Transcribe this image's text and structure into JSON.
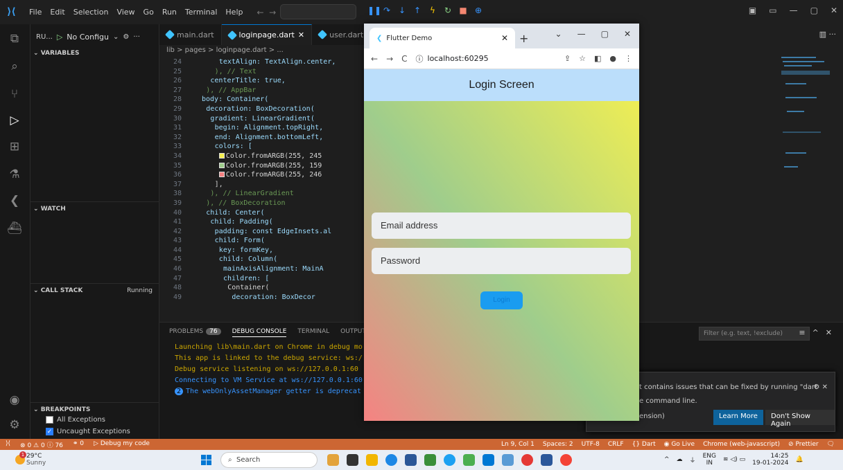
{
  "titlebar": {
    "menu": [
      "File",
      "Edit",
      "Selection",
      "View",
      "Go",
      "Run",
      "Terminal",
      "Help"
    ]
  },
  "sidebar": {
    "run_label": "RU...",
    "config_label": "No Configu",
    "sections": {
      "variables": "VARIABLES",
      "watch": "WATCH",
      "call_stack": "CALL STACK",
      "call_stack_status": "Running",
      "breakpoints": "BREAKPOINTS"
    },
    "breakpoints": [
      {
        "label": "All Exceptions",
        "checked": false
      },
      {
        "label": "Uncaught Exceptions",
        "checked": true
      }
    ]
  },
  "editor": {
    "tabs": [
      {
        "label": "main.dart",
        "active": false
      },
      {
        "label": "loginpage.dart",
        "active": true
      },
      {
        "label": "user.dart",
        "active": false
      }
    ],
    "breadcrumb": "lib > pages > loginpage.dart > ...",
    "lines": [
      {
        "n": "24",
        "code": "textAlign: TextAlign.center,"
      },
      {
        "n": "25",
        "code": "), // Text"
      },
      {
        "n": "26",
        "code": "centerTitle: true,"
      },
      {
        "n": "27",
        "code": "), // AppBar"
      },
      {
        "n": "28",
        "code": "body: Container("
      },
      {
        "n": "29",
        "code": "decoration: BoxDecoration("
      },
      {
        "n": "30",
        "code": "gradient: LinearGradient("
      },
      {
        "n": "31",
        "code": "begin: Alignment.topRight,"
      },
      {
        "n": "32",
        "code": "end: Alignment.bottomLeft,"
      },
      {
        "n": "33",
        "code": "colors: ["
      },
      {
        "n": "34",
        "code": "Color.fromARGB(255, 245"
      },
      {
        "n": "35",
        "code": "Color.fromARGB(255, 159"
      },
      {
        "n": "36",
        "code": "Color.fromARGB(255, 246"
      },
      {
        "n": "37",
        "code": "],"
      },
      {
        "n": "38",
        "code": "), // LinearGradient"
      },
      {
        "n": "39",
        "code": "), // BoxDecoration"
      },
      {
        "n": "40",
        "code": "child: Center("
      },
      {
        "n": "41",
        "code": "child: Padding("
      },
      {
        "n": "42",
        "code": "padding: const EdgeInsets.al"
      },
      {
        "n": "43",
        "code": "child: Form("
      },
      {
        "n": "44",
        "code": "key: formKey,"
      },
      {
        "n": "45",
        "code": "child: Column("
      },
      {
        "n": "46",
        "code": "mainAxisAlignment: MainA"
      },
      {
        "n": "47",
        "code": "children: ["
      },
      {
        "n": "48",
        "code": "Container("
      },
      {
        "n": "49",
        "code": "decoration: BoxDecor"
      }
    ]
  },
  "panel": {
    "tabs": [
      "PROBLEMS",
      "DEBUG CONSOLE",
      "TERMINAL",
      "OUTPUT"
    ],
    "problems_count": "76",
    "filter_placeholder": "Filter (e.g. text, !exclude)",
    "console": [
      "Launching lib\\main.dart on Chrome in debug mo",
      "This app is linked to the debug service: ws:/",
      "Debug service listening on ws://127.0.0.1:60",
      "Connecting to VM Service at ws://127.0.0.1:60",
      "The webOnlyAssetManager getter is deprecat"
    ],
    "console_count": "2"
  },
  "notification": {
    "message": "t contains issues that can be fixed by running \"dart",
    "message2": "e command line.",
    "extension": "ension)",
    "learn_more": "Learn More",
    "dont_show": "Don't Show Again"
  },
  "statusbar": {
    "errors": "0",
    "warnings": "0",
    "infos": "76",
    "ports": "0",
    "debug": "Debug my code",
    "position": "Ln 9, Col 1",
    "spaces": "Spaces: 2",
    "encoding": "UTF-8",
    "eol": "CRLF",
    "lang": "{} Dart",
    "golive": "Go Live",
    "device": "Chrome (web-javascript)",
    "prettier": "Prettier"
  },
  "browser": {
    "tab_title": "Flutter Demo",
    "url": "localhost:60295",
    "app_title": "Login Screen",
    "email_placeholder": "Email address",
    "password_placeholder": "Password",
    "login_label": "Login",
    "gradient_colors": [
      "#f5f050",
      "#9fcd8c",
      "#f68282"
    ],
    "appbar_color": "#bbdefb"
  },
  "taskbar": {
    "temp": "29°C",
    "weather": "Sunny",
    "weather_badge": "1",
    "search": "Search",
    "lang1": "ENG",
    "lang2": "IN",
    "time": "14:25",
    "date": "19-01-2024"
  },
  "colors": {
    "statusbar": "#cc6633",
    "accent": "#0078d4"
  }
}
